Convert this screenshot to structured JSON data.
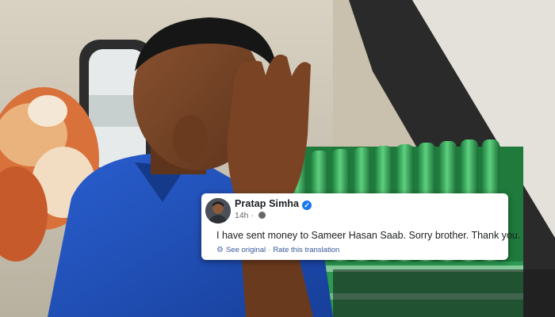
{
  "post": {
    "author": "Pratap Simha",
    "time": "14h",
    "text": "I have sent money to Sameer Hasan Saab. Sorry brother. Thank you.",
    "see_original": "See original",
    "separator": "·",
    "rate_translation": "Rate this translation",
    "verified_icon": "verified-badge-icon",
    "privacy_icon": "globe-icon",
    "translate_icon": "gear-icon"
  },
  "colors": {
    "shirt": "#1f4fb8",
    "bottles": "#2f9a55",
    "facebook_blue": "#1877f2",
    "link_blue": "#385898"
  }
}
